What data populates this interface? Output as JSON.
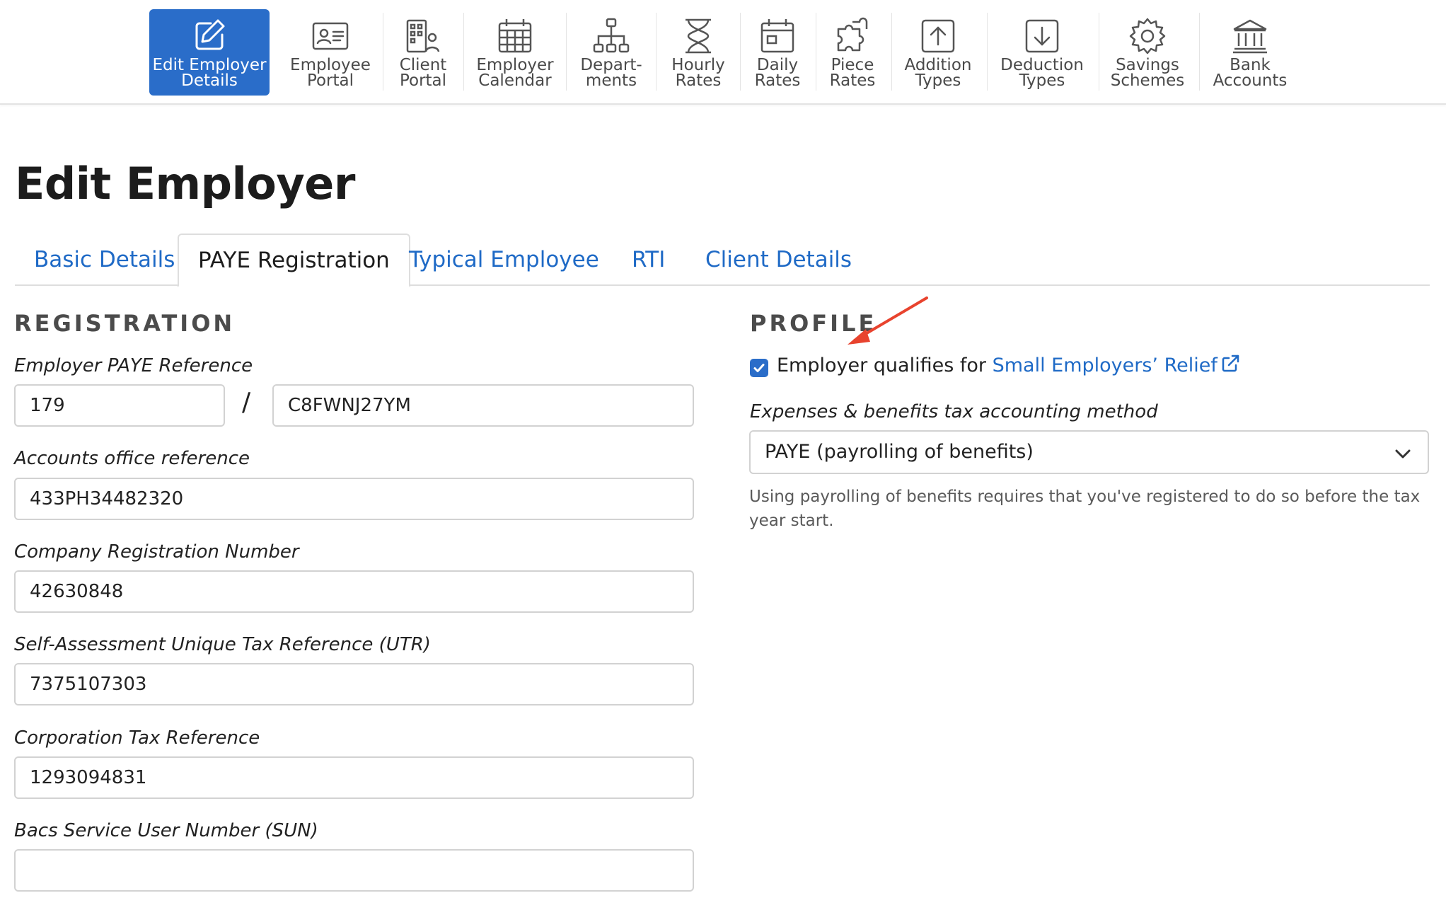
{
  "toolbar": {
    "items": [
      {
        "label": "Edit Employer\nDetails",
        "icon": "edit-icon"
      },
      {
        "label": "Employee\nPortal",
        "icon": "id-card-icon"
      },
      {
        "label": "Client\nPortal",
        "icon": "building-people-icon"
      },
      {
        "label": "Employer\nCalendar",
        "icon": "calendar-grid-icon"
      },
      {
        "label": "Depart-\nments",
        "icon": "org-chart-icon"
      },
      {
        "label": "Hourly\nRates",
        "icon": "hourglass-icon"
      },
      {
        "label": "Daily\nRates",
        "icon": "calendar-day-icon"
      },
      {
        "label": "Piece\nRates",
        "icon": "puzzle-icon"
      },
      {
        "label": "Addition\nTypes",
        "icon": "upload-box-icon"
      },
      {
        "label": "Deduction\nTypes",
        "icon": "download-box-icon"
      },
      {
        "label": "Savings\nSchemes",
        "icon": "gear-icon"
      },
      {
        "label": "Bank\nAccounts",
        "icon": "bank-icon"
      }
    ]
  },
  "page": {
    "title": "Edit Employer"
  },
  "tabs": [
    "Basic Details",
    "PAYE Registration",
    "Typical Employee",
    "RTI",
    "Client Details"
  ],
  "registration": {
    "heading": "REGISTRATION",
    "paye_label": "Employer PAYE Reference",
    "paye_office": "179",
    "paye_separator": "/",
    "paye_ref": "C8FWNJ27YM",
    "aor_label": "Accounts office reference",
    "aor_value": "433PH34482320",
    "crn_label": "Company Registration Number",
    "crn_value": "42630848",
    "utr_label": "Self-Assessment Unique Tax Reference (UTR)",
    "utr_value": "7375107303",
    "ctr_label": "Corporation Tax Reference",
    "ctr_value": "1293094831",
    "sun_label": "Bacs Service User Number (SUN)",
    "sun_value": ""
  },
  "profile": {
    "heading": "PROFILE",
    "ser_text": "Employer qualifies for ",
    "ser_link": "Small Employers’ Relief",
    "ser_checked": true,
    "method_label": "Expenses & benefits tax accounting method",
    "method_value": "PAYE (payrolling of benefits)",
    "method_help": "Using payrolling of benefits requires that you've registered to do so before the tax year start."
  },
  "colors": {
    "accent": "#2a6dc9",
    "link": "#1f6ac6",
    "annotation_arrow": "#e8432e"
  }
}
